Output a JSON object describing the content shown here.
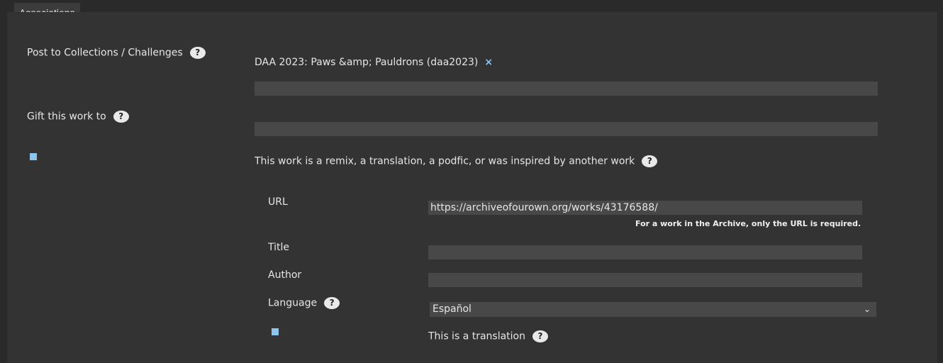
{
  "fieldset": {
    "legend": "Associations"
  },
  "collections": {
    "label": "Post to Collections / Challenges",
    "help": "?",
    "tag": "DAA 2023: Paws &amp; Pauldrons (daa2023)",
    "remove": "×",
    "input_value": ""
  },
  "gift": {
    "label": "Gift this work to",
    "help": "?",
    "input_value": ""
  },
  "remix": {
    "label": "This work is a remix, a translation, a podfic, or was inspired by another work",
    "help": "?"
  },
  "parent": {
    "url_label": "URL",
    "url_value": "https://archiveofourown.org/works/43176588/",
    "url_note": "For a work in the Archive, only the URL is required.",
    "title_label": "Title",
    "title_value": "",
    "author_label": "Author",
    "author_value": "",
    "language_label": "Language",
    "language_help": "?",
    "language_value": "Español",
    "translation_label": "This is a translation",
    "translation_help": "?"
  },
  "colors": {
    "accent": "#8ec5ec",
    "panel": "#333333",
    "input": "#484848"
  }
}
